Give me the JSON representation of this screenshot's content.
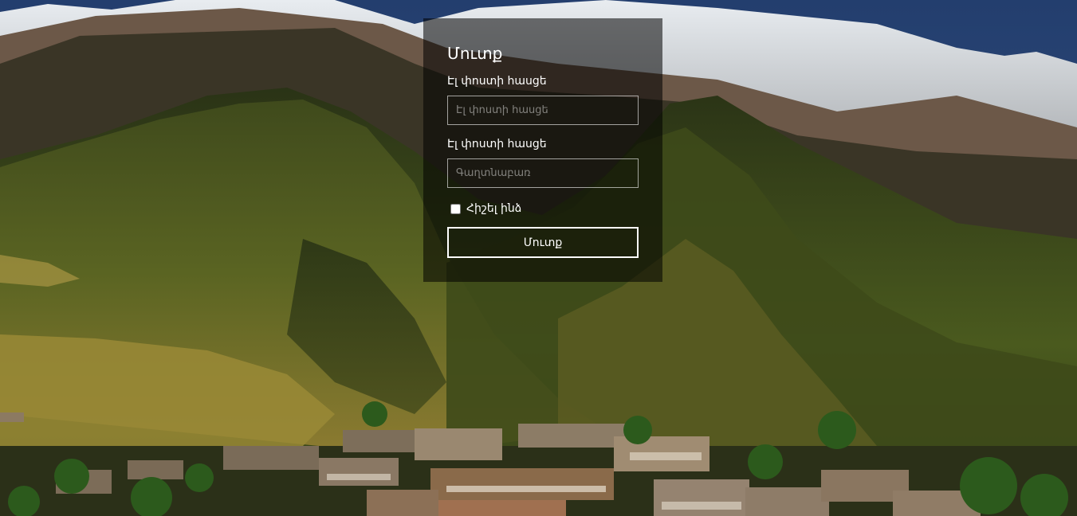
{
  "login": {
    "title": "Մուտք",
    "email_label": "Էլ փոստի հասցե",
    "email_placeholder": "Էլ փոստի հասցե",
    "email_value": "",
    "password_label": "Էլ փոստի հասցե",
    "password_placeholder": "Գաղտնաբառ",
    "password_value": "",
    "remember_label": "Հիշել ինձ",
    "remember_checked": false,
    "submit_label": "Մուտք"
  }
}
